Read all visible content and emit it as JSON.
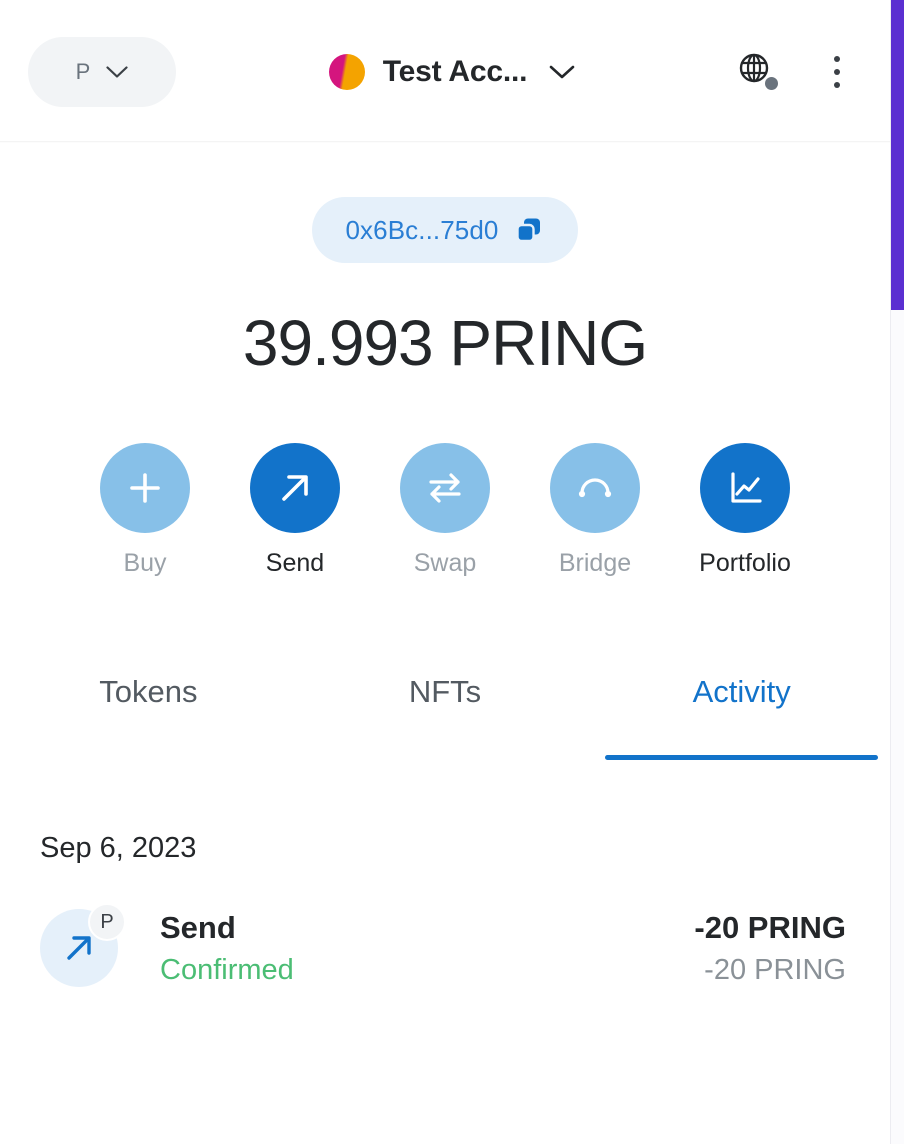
{
  "header": {
    "network": {
      "label": "P",
      "chevron_icon": "chevron-down-icon"
    },
    "account": {
      "name": "Test Acc...",
      "avatar_icon": "account-avatar",
      "chevron_icon": "chevron-down-icon"
    },
    "connection": {
      "icon": "globe-icon",
      "status_dot": "connection-status-dot"
    },
    "menu": {
      "icon": "kebab-menu-icon"
    }
  },
  "address": {
    "short": "0x6Bc...75d0",
    "copy_icon": "copy-icon"
  },
  "balance": {
    "amount": "39.993",
    "symbol": "PRING",
    "display": "39.993 PRING"
  },
  "actions": [
    {
      "label": "Buy",
      "icon": "plus-icon",
      "enabled": false
    },
    {
      "label": "Send",
      "icon": "arrow-up-right-icon",
      "enabled": true
    },
    {
      "label": "Swap",
      "icon": "swap-arrows-icon",
      "enabled": false
    },
    {
      "label": "Bridge",
      "icon": "bridge-arc-icon",
      "enabled": false
    },
    {
      "label": "Portfolio",
      "icon": "chart-line-icon",
      "enabled": true
    }
  ],
  "tabs": [
    {
      "label": "Tokens",
      "active": false
    },
    {
      "label": "NFTs",
      "active": false
    },
    {
      "label": "Activity",
      "active": true
    }
  ],
  "activity": {
    "date_group": "Sep 6, 2023",
    "transactions": [
      {
        "title": "Send",
        "status": "Confirmed",
        "primary_amount": "-20 PRING",
        "secondary_amount": "-20 PRING",
        "icon": "arrow-up-right-icon",
        "network_badge": "P"
      }
    ]
  },
  "colors": {
    "accent_blue": "#1273ca",
    "accent_blue_muted": "#87c0e8",
    "link_blue": "#2a7ed4",
    "pill_bg": "#e5f0fa",
    "success_green": "#4bbd74",
    "text_dark": "#24272a",
    "text_muted": "#8a9197",
    "scrollbar_purple": "#5b2fd1"
  }
}
